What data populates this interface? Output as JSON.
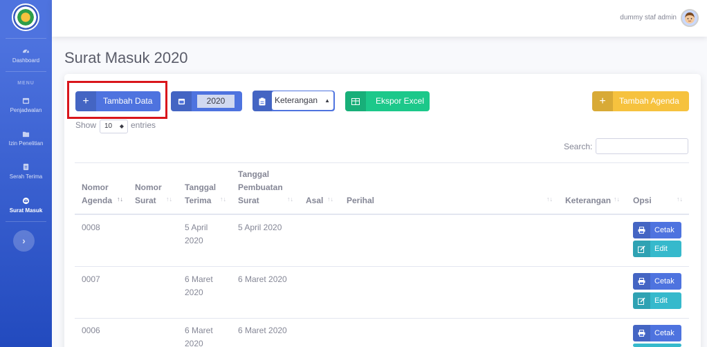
{
  "sidebar": {
    "items": [
      {
        "label": "Dashboard",
        "icon": "gauge-icon"
      },
      {
        "label": "Penjadwalan",
        "icon": "calendar-icon"
      },
      {
        "label": "Izin Penelitian",
        "icon": "folder-icon"
      },
      {
        "label": "Serah Terima",
        "icon": "file-icon"
      },
      {
        "label": "Surat Masuk",
        "icon": "envelope-icon"
      }
    ],
    "heading": "MENU",
    "toggle_icon": "chevron-right-icon"
  },
  "topbar": {
    "user_name": "dummy staf admin"
  },
  "page": {
    "title": "Surat Masuk 2020"
  },
  "toolbar": {
    "add_label": "Tambah Data",
    "year_value": "2020",
    "filter_selected": "Keterangan",
    "export_label": "Ekspor Excel",
    "add_agenda_label": "Tambah Agenda"
  },
  "datatable": {
    "show_label": "Show",
    "entries_value": "10",
    "entries_label": "entries",
    "search_label": "Search:"
  },
  "table": {
    "headers": {
      "nomor_agenda": [
        "Nomor",
        "Agenda"
      ],
      "nomor_surat": [
        "Nomor",
        "Surat"
      ],
      "tanggal_terima": [
        "Tanggal",
        "Terima"
      ],
      "tanggal_pembuatan": [
        "Tanggal",
        "Pembuatan",
        "Surat"
      ],
      "asal": "Asal",
      "perihal": "Perihal",
      "keterangan": "Keterangan",
      "opsi": "Opsi"
    },
    "rows": [
      {
        "agenda": "0008",
        "terima": [
          "5 April",
          "2020"
        ],
        "pembuatan": "5 April 2020"
      },
      {
        "agenda": "0007",
        "terima": [
          "6 Maret",
          "2020"
        ],
        "pembuatan": "6 Maret 2020"
      },
      {
        "agenda": "0006",
        "terima": [
          "6 Maret",
          "2020"
        ],
        "pembuatan": "6 Maret 2020"
      }
    ],
    "actions": {
      "print": "Cetak",
      "edit": "Edit"
    }
  },
  "colors": {
    "primary": "#4e73df",
    "success": "#1cc88a",
    "warning": "#f6c23e",
    "info": "#36b9cc",
    "highlight": "#d9151b"
  }
}
